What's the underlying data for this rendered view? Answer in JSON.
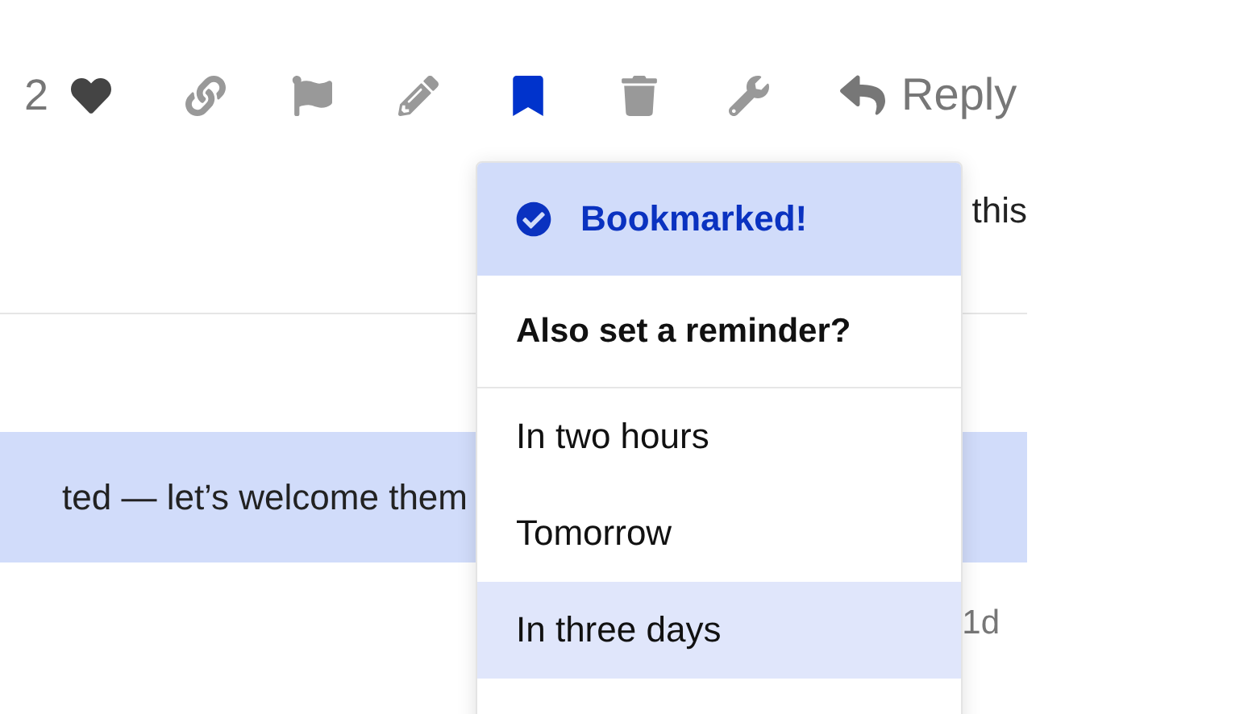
{
  "post_actions": {
    "like_count": "2",
    "liked": true,
    "bookmarked": true,
    "reply_label": "Reply"
  },
  "post_text_fragment": "this",
  "topic_row": {
    "text": "ted — let’s welcome them",
    "highlighted": true
  },
  "topic_age": "1d",
  "bookmark_menu": {
    "status": "Bookmarked!",
    "prompt": "Also set a reminder?",
    "options": [
      {
        "label": "In two hours",
        "selected": false
      },
      {
        "label": "Tomorrow",
        "selected": false
      },
      {
        "label": "In three days",
        "selected": true
      }
    ]
  }
}
